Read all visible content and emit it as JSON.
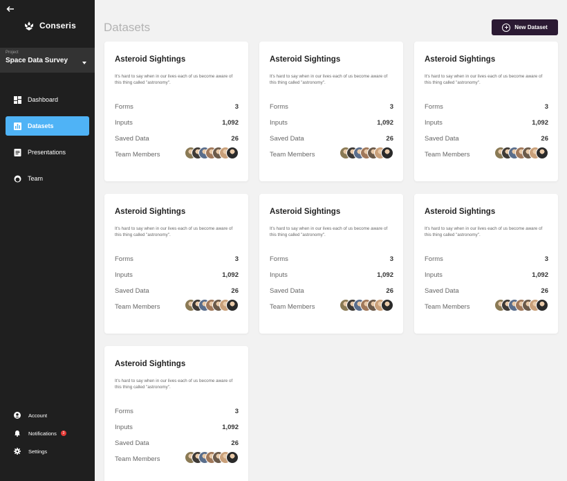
{
  "app": {
    "name": "Conseris"
  },
  "project": {
    "label": "Project",
    "name": "Space Data Survey"
  },
  "nav": [
    {
      "label": "Dashboard",
      "icon": "dashboard-icon",
      "active": false
    },
    {
      "label": "Datasets",
      "icon": "chart-icon",
      "active": true
    },
    {
      "label": "Presentations",
      "icon": "document-icon",
      "active": false
    },
    {
      "label": "Team",
      "icon": "team-icon",
      "active": false
    }
  ],
  "bottom_nav": {
    "account": "Account",
    "notifications": "Notifications",
    "notifications_badge": "3",
    "settings": "Settings"
  },
  "page": {
    "title": "Datasets",
    "new_button": "New Dataset"
  },
  "colors": {
    "sidebar": "#1f1f1f",
    "active_nav": "#4fb3f6",
    "primary_button": "#2b1a33",
    "background": "#f2f2f2",
    "badge": "#e53935"
  },
  "stat_labels": {
    "forms": "Forms",
    "inputs": "Inputs",
    "saved": "Saved Data",
    "team": "Team Members"
  },
  "avatar_colors": [
    "#8a7a55",
    "#3e3a36",
    "#5a6e8c",
    "#a0785a",
    "#6b5a4a",
    "#c9a07a",
    "#2a2a2a"
  ],
  "cards": [
    {
      "title": "Asteroid Sightings",
      "description": "It's hard to say when in our lives each of us become aware of this thing called \"astronomy\".",
      "forms": "3",
      "inputs": "1,092",
      "saved": "26"
    },
    {
      "title": "Asteroid Sightings",
      "description": "It's hard to say when in our lives each of us become aware of this thing called \"astronomy\".",
      "forms": "3",
      "inputs": "1,092",
      "saved": "26"
    },
    {
      "title": "Asteroid Sightings",
      "description": "It's hard to say when in our lives each of us become aware of this thing called \"astronomy\".",
      "forms": "3",
      "inputs": "1,092",
      "saved": "26"
    },
    {
      "title": "Asteroid Sightings",
      "description": "It's hard to say when in our lives each of us become aware of this thing called \"astronomy\".",
      "forms": "3",
      "inputs": "1,092",
      "saved": "26"
    },
    {
      "title": "Asteroid Sightings",
      "description": "It's hard to say when in our lives each of us become aware of this thing called \"astronomy\".",
      "forms": "3",
      "inputs": "1,092",
      "saved": "26"
    },
    {
      "title": "Asteroid Sightings",
      "description": "It's hard to say when in our lives each of us become aware of this thing called \"astronomy\".",
      "forms": "3",
      "inputs": "1,092",
      "saved": "26"
    },
    {
      "title": "Asteroid Sightings",
      "description": "It's hard to say when in our lives each of us become aware of this thing called \"astronomy\".",
      "forms": "3",
      "inputs": "1,092",
      "saved": "26"
    }
  ]
}
